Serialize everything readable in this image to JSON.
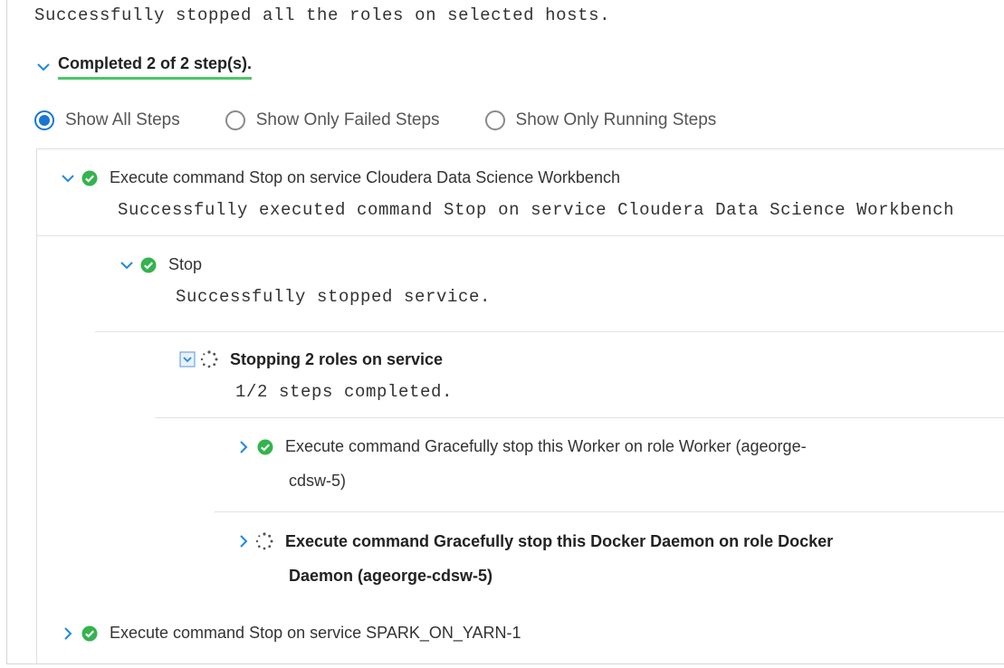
{
  "summary": "Successfully stopped all the roles on selected hosts.",
  "progress": {
    "label": "Completed 2 of 2 step(s)."
  },
  "filters": [
    {
      "label": "Show All Steps",
      "selected": true
    },
    {
      "label": "Show Only Failed Steps",
      "selected": false
    },
    {
      "label": "Show Only Running Steps",
      "selected": false
    }
  ],
  "steps": {
    "cdsw": {
      "title": "Execute command Stop on service Cloudera Data Science Workbench",
      "detail": "Successfully executed command Stop on service Cloudera Data Science Workbench",
      "status": "success",
      "expanded": true
    },
    "stop": {
      "title": "Stop",
      "detail": "Successfully stopped service.",
      "status": "success",
      "expanded": true
    },
    "stopping_roles": {
      "title": "Stopping 2 roles on service",
      "detail": "1/2 steps completed.",
      "status": "running",
      "expanded": true
    },
    "worker": {
      "title_line1": "Execute command Gracefully stop this Worker on role Worker (ageorge-",
      "title_line2": "cdsw-5)",
      "status": "success",
      "expanded": false
    },
    "docker": {
      "title_line1": "Execute command Gracefully stop this Docker Daemon on role Docker",
      "title_line2": "Daemon (ageorge-cdsw-5)",
      "status": "running",
      "expanded": false
    },
    "spark": {
      "title": "Execute command Stop on service SPARK_ON_YARN-1",
      "status": "success",
      "expanded": false
    }
  },
  "colors": {
    "accent": "#1e88e5",
    "success": "#34b34e",
    "progress_underline": "#4cc66b",
    "radio_selected": "#1976d2"
  },
  "icons": {
    "expanded": "chevron-down-icon",
    "collapsed": "chevron-right-icon",
    "success": "check-circle-icon",
    "running": "spinner-icon"
  }
}
